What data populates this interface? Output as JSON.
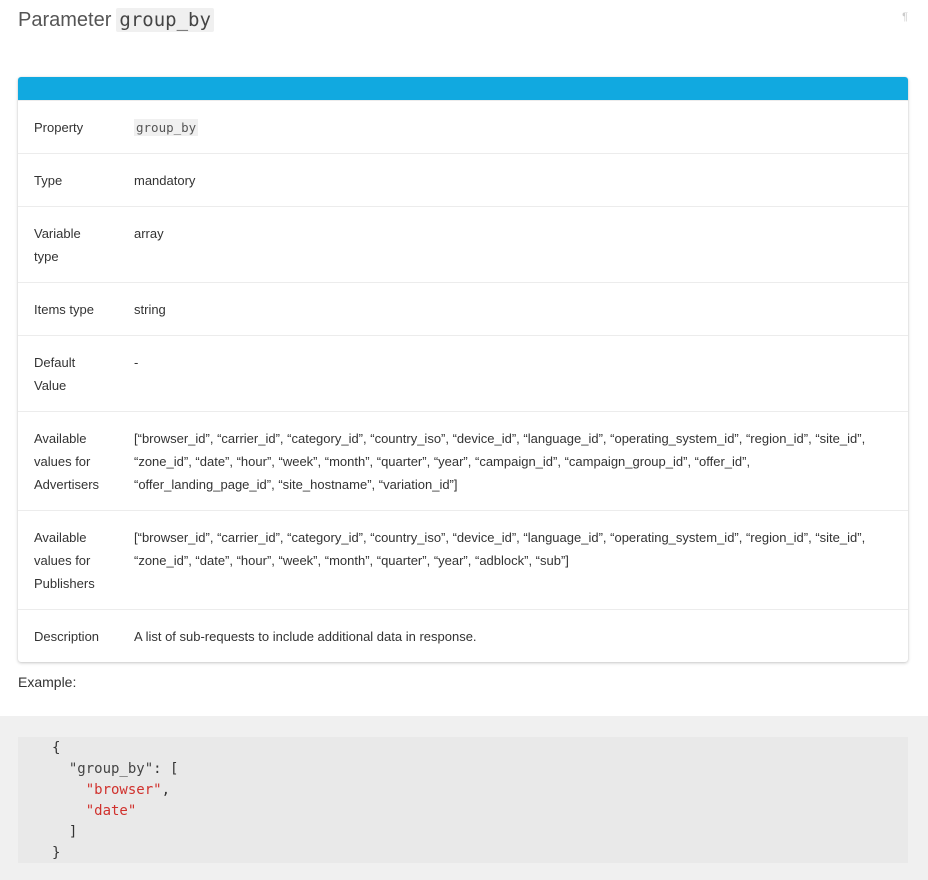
{
  "heading": {
    "prefix": "Parameter",
    "code": "group_by",
    "anchor": "¶"
  },
  "card": {
    "accent_color": "#11a9e0",
    "rows": [
      {
        "key": "Property",
        "value": "group_by"
      },
      {
        "key": "Type",
        "value": "mandatory"
      },
      {
        "key": "Variable type",
        "value": "array"
      },
      {
        "key": "Items type",
        "value": "string"
      },
      {
        "key": "Default Value",
        "value": "-"
      },
      {
        "key": "Available values for Advertisers",
        "value": "[“browser_id”, “carrier_id”, “category_id”, “country_iso”, “device_id”, “language_id”, “operating_system_id”, “region_id”, “site_id”, “zone_id”, “date”, “hour”, “week”, “month”, “quarter”, “year”, “campaign_id”, “campaign_group_id”, “offer_id”, “offer_landing_page_id”, “site_hostname”, “variation_id”]"
      },
      {
        "key": "Available values for Publishers",
        "value": "[“browser_id”, “carrier_id”, “category_id”, “country_iso”, “device_id”, “language_id”, “operating_system_id”, “region_id”, “site_id”, “zone_id”, “date”, “hour”, “week”, “month”, “quarter”, “year”, “adblock”, “sub”]"
      },
      {
        "key": "Description",
        "value": "A list of sub-requests to include additional data in response."
      }
    ]
  },
  "example": {
    "label": "Example:",
    "code": {
      "open_brace": "{",
      "key": "\"group_by\"",
      "key_suffix": ": [",
      "items": [
        "\"browser\"",
        "\"date\""
      ],
      "close_bracket": "]",
      "close_brace": "}"
    }
  }
}
